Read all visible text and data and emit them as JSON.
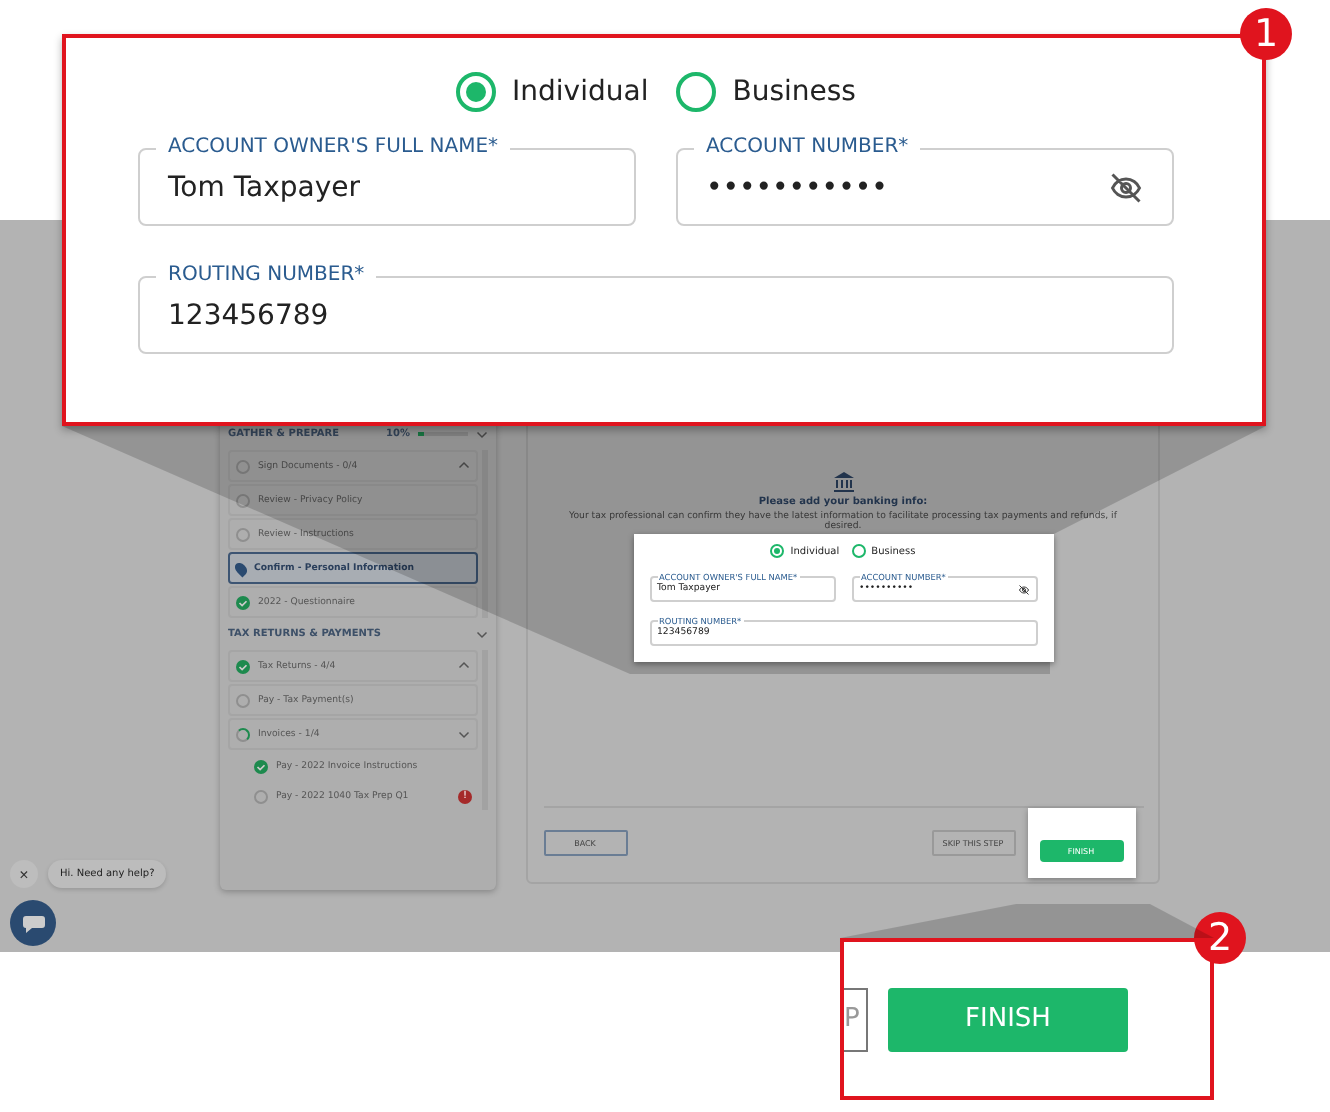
{
  "sidebar": {
    "sections": [
      {
        "title": "GATHER & PREPARE",
        "percent": "10%",
        "level": 0.1,
        "items": [
          {
            "label": "Sign Documents - 0/4",
            "kind": "empty",
            "selected": false,
            "expanded": true
          },
          {
            "label": "Review - Privacy Policy",
            "kind": "empty",
            "selected": false
          },
          {
            "label": "Review - Instructions",
            "kind": "empty",
            "selected": false
          },
          {
            "label": "Confirm - Personal Information",
            "kind": "current",
            "selected": true
          },
          {
            "label": "2022 - Questionnaire",
            "kind": "done",
            "selected": false
          }
        ]
      },
      {
        "title": "TAX RETURNS & PAYMENTS",
        "items": [
          {
            "label": "Tax Returns - 4/4",
            "kind": "done",
            "selected": false,
            "expanded": true
          },
          {
            "label": "Pay - Tax Payment(s)",
            "kind": "empty",
            "selected": false
          },
          {
            "label": "Invoices - 1/4",
            "kind": "partial",
            "selected": false,
            "expanded": false,
            "children": [
              {
                "label": "Pay - 2022 Invoice Instructions",
                "kind": "done",
                "selected": false
              },
              {
                "label": "Pay - 2022 1040 Tax Prep Q1",
                "kind": "empty",
                "selected": false,
                "badge": "!"
              }
            ]
          }
        ]
      }
    ]
  },
  "main": {
    "title": "Please add your banking info:",
    "text": "Your tax professional can confirm they have the latest information to facilitate processing tax payments and refunds, if desired.",
    "form": {
      "options": [
        {
          "label": "Individual",
          "selected": true
        },
        {
          "label": "Business",
          "selected": false
        }
      ],
      "fields": [
        {
          "label": "ACCOUNT OWNER'S FULL NAME*",
          "value": "Tom Taxpayer"
        },
        {
          "label": "ACCOUNT NUMBER*",
          "value": "••••••••••",
          "masked": true
        },
        {
          "label": "ROUTING NUMBER*",
          "value": "123456789"
        }
      ]
    },
    "buttons": {
      "back": "BACK",
      "skip": "SKIP THIS STEP",
      "finish": "FINISH"
    }
  },
  "chat": {
    "close": "×",
    "message": "Hi. Need any help?"
  },
  "callout_1": {
    "number": "1",
    "options": [
      {
        "label": "Individual",
        "selected": true
      },
      {
        "label": "Business",
        "selected": false
      }
    ],
    "fields": [
      {
        "label": "ACCOUNT OWNER'S FULL NAME*",
        "value": "Tom Taxpayer"
      },
      {
        "label": "ACCOUNT NUMBER*",
        "value": "•••••••••••",
        "masked": true
      },
      {
        "label": "ROUTING NUMBER*",
        "value": "123456789"
      }
    ]
  },
  "callout_2": {
    "number": "2",
    "skip_fragment": "P",
    "finish": "FINISH"
  }
}
